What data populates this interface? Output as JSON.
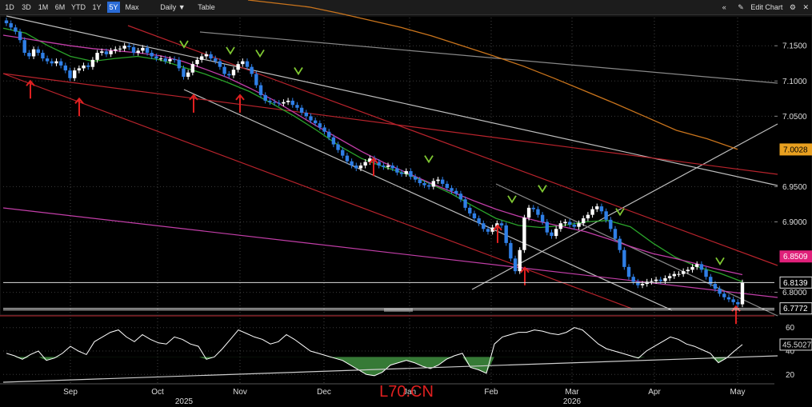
{
  "toolbar": {
    "ranges": [
      "1D",
      "3D",
      "1M",
      "6M",
      "YTD",
      "1Y",
      "5Y",
      "Max"
    ],
    "active_range": "5Y",
    "interval": "Daily",
    "interval_arrow": "▼",
    "table_label": "Table",
    "collapse_icon": "«",
    "edit_icon": "✎",
    "edit_label": "Edit Chart",
    "gear_icon": "⚙",
    "close_icon": "✕"
  },
  "watermark": "L70.CN",
  "colors": {
    "up_candle": "#ffffff",
    "down_candle": "#2f7fe6",
    "ma_green": "#2aa32a",
    "ma_purple": "#c23ea8",
    "ma_orange": "#c9741c",
    "ma_red": "#b8232c",
    "trend_white": "#bdbdbd",
    "rsi_line": "#ffffff",
    "rsi_fill": "#3f8f3f",
    "arrow_up": "#e02020",
    "arrow_down": "#7fc832"
  },
  "chart_data": [
    {
      "type": "candlestick",
      "title": "",
      "y_ticks": [
        "7.1500",
        "7.1000",
        "7.0500",
        "6.9500",
        "6.9000",
        "6.8000"
      ],
      "y_range": [
        6.77,
        7.19
      ],
      "x_ticks": [
        "Sep",
        "Oct",
        "Nov",
        "Dec",
        "Jan",
        "Feb",
        "Mar",
        "Apr",
        "May"
      ],
      "year_labels": [
        "2025",
        "2026"
      ],
      "price_tags": [
        {
          "label": "7.0028",
          "value": 7.0028,
          "bg": "#e8a020",
          "fg": "#000000"
        },
        {
          "label": "6.8509",
          "value": 6.8509,
          "bg": "#e0207a",
          "fg": "#ffffff"
        },
        {
          "label": "6.8139",
          "value": 6.8139,
          "bg": "#000000",
          "fg": "#ffffff"
        },
        {
          "label": "6.7772",
          "value": 6.7772,
          "bg": "#000000",
          "fg": "#ffffff"
        }
      ],
      "close_series": [
        7.182,
        7.176,
        7.17,
        7.158,
        7.14,
        7.135,
        7.145,
        7.14,
        7.132,
        7.128,
        7.125,
        7.128,
        7.122,
        7.115,
        7.104,
        7.115,
        7.118,
        7.122,
        7.12,
        7.13,
        7.14,
        7.142,
        7.138,
        7.143,
        7.145,
        7.146,
        7.15,
        7.148,
        7.14,
        7.143,
        7.147,
        7.14,
        7.135,
        7.132,
        7.132,
        7.128,
        7.131,
        7.13,
        7.118,
        7.106,
        7.112,
        7.124,
        7.13,
        7.135,
        7.138,
        7.132,
        7.128,
        7.12,
        7.11,
        7.108,
        7.116,
        7.124,
        7.128,
        7.12,
        7.11,
        7.094,
        7.08,
        7.072,
        7.07,
        7.069,
        7.068,
        7.07,
        7.072,
        7.066,
        7.062,
        7.055,
        7.05,
        7.044,
        7.04,
        7.034,
        7.028,
        7.02,
        7.01,
        7.002,
        6.994,
        6.986,
        6.98,
        6.976,
        6.98,
        6.985,
        6.99,
        6.985,
        6.98,
        6.978,
        6.98,
        6.976,
        6.97,
        6.968,
        6.972,
        6.964,
        6.96,
        6.955,
        6.952,
        6.95,
        6.958,
        6.96,
        6.954,
        6.948,
        6.944,
        6.94,
        6.932,
        6.92,
        6.912,
        6.905,
        6.898,
        6.89,
        6.886,
        6.892,
        6.898,
        6.895,
        6.87,
        6.848,
        6.83,
        6.86,
        6.906,
        6.92,
        6.918,
        6.91,
        6.9,
        6.885,
        6.88,
        6.89,
        6.898,
        6.9,
        6.896,
        6.893,
        6.898,
        6.905,
        6.91,
        6.918,
        6.922,
        6.915,
        6.903,
        6.89,
        6.876,
        6.86,
        6.836,
        6.822,
        6.815,
        6.81,
        6.812,
        6.815,
        6.816,
        6.818,
        6.816,
        6.82,
        6.823,
        6.826,
        6.826,
        6.83,
        6.832,
        6.836,
        6.84,
        6.832,
        6.822,
        6.812,
        6.805,
        6.798,
        6.793,
        6.79,
        6.786,
        6.783,
        6.814
      ],
      "moving_averages": [
        {
          "color": "ma_green",
          "values": [
            7.175,
            7.168,
            7.15,
            7.135,
            7.128,
            7.132,
            7.135,
            7.13,
            7.12,
            7.11,
            7.098,
            7.085,
            7.068,
            7.05,
            7.03,
            7.008,
            6.99,
            6.978,
            6.968,
            6.955,
            6.94,
            6.922,
            6.905,
            6.895,
            6.892,
            6.895,
            6.9,
            6.902,
            6.893,
            6.87,
            6.85,
            6.836,
            6.827,
            6.815
          ]
        },
        {
          "color": "ma_purple",
          "values": [
            7.165,
            7.16,
            7.155,
            7.15,
            7.146,
            7.143,
            7.14,
            7.136,
            7.128,
            7.117,
            7.105,
            7.09,
            7.074,
            7.055,
            7.036,
            7.018,
            7.0,
            6.984,
            6.97,
            6.956,
            6.943,
            6.93,
            6.918,
            6.908,
            6.9,
            6.893,
            6.886,
            6.876,
            6.865,
            6.855,
            6.848,
            6.84,
            6.832,
            6.825
          ]
        },
        {
          "color": "ma_orange",
          "values": [
            7.215,
            7.21,
            7.205,
            7.196,
            7.186,
            7.176,
            7.164,
            7.15,
            7.136,
            7.121,
            7.104,
            7.086,
            7.068,
            7.049,
            7.03,
            7.018,
            7.003
          ]
        }
      ],
      "up_arrows": [
        7.1,
        7.075,
        7.08,
        7.08,
        6.99,
        6.895,
        6.835,
        6.78
      ],
      "down_arrows": [
        7.148,
        7.139,
        7.135,
        7.11,
        6.985,
        6.928,
        6.943,
        6.91,
        6.84
      ],
      "horizontal_levels": [
        6.8139,
        6.7772,
        6.775
      ]
    },
    {
      "type": "line",
      "title": "",
      "y_ticks": [
        "60",
        "40",
        "20"
      ],
      "y_range": [
        12,
        68
      ],
      "last_value_label": "45.5027",
      "last_value": 45.5027,
      "fill_below": 35,
      "series": [
        {
          "values": [
            38,
            36,
            33,
            37,
            40,
            32,
            34,
            38,
            44,
            40,
            37,
            48,
            52,
            56,
            58,
            52,
            48,
            54,
            50,
            47,
            46,
            52,
            50,
            46,
            44,
            33,
            35,
            42,
            50,
            58,
            55,
            52,
            50,
            46,
            48,
            54,
            50,
            45,
            40,
            38,
            36,
            34,
            32,
            28,
            24,
            20,
            19,
            22,
            28,
            30,
            32,
            30,
            27,
            25,
            28,
            33,
            36,
            38,
            26,
            24,
            21,
            46,
            52,
            54,
            56,
            56,
            58,
            57,
            55,
            54,
            56,
            60,
            58,
            52,
            46,
            42,
            40,
            38,
            36,
            34,
            40,
            44,
            48,
            52,
            50,
            46,
            44,
            41,
            38,
            30,
            34,
            40,
            45.5
          ]
        }
      ]
    }
  ]
}
